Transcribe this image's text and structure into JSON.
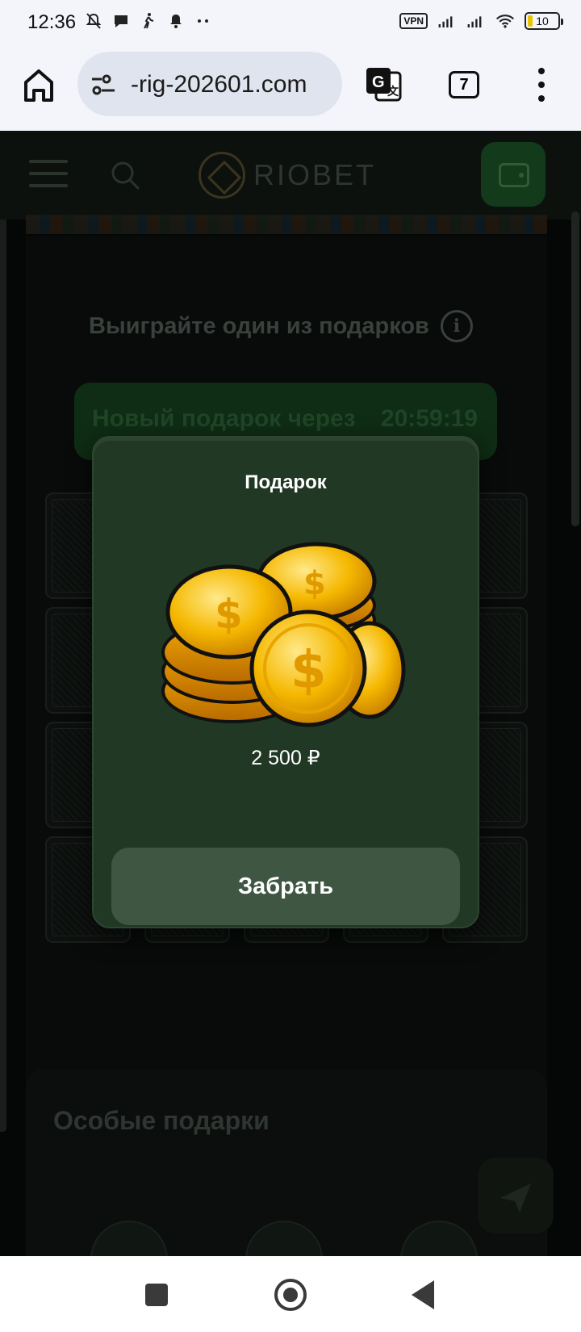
{
  "status_bar": {
    "time": "12:36",
    "left_icons": [
      "notifications-off-icon",
      "chat-bubble-icon",
      "walking-icon",
      "bell-icon",
      "more-dots-icon"
    ],
    "vpn_label": "VPN",
    "battery": "10"
  },
  "browser": {
    "url": "-rig-202601.com",
    "tab_count": "7"
  },
  "page": {
    "logo_text": "RIOBET",
    "gifts_heading": "Выиграйте один из подарков",
    "timer_label": "Новый подарок через",
    "timer_value": "20:59:19",
    "special_heading": "Особые подарки"
  },
  "modal": {
    "title": "Подарок",
    "prize_amount": "2 500 ₽",
    "claim_label": "Забрать"
  },
  "colors": {
    "modal_bg": "#213824",
    "claim_button": "#3e5642",
    "page_bg": "#050706",
    "coin_gold": "#f2b705"
  }
}
